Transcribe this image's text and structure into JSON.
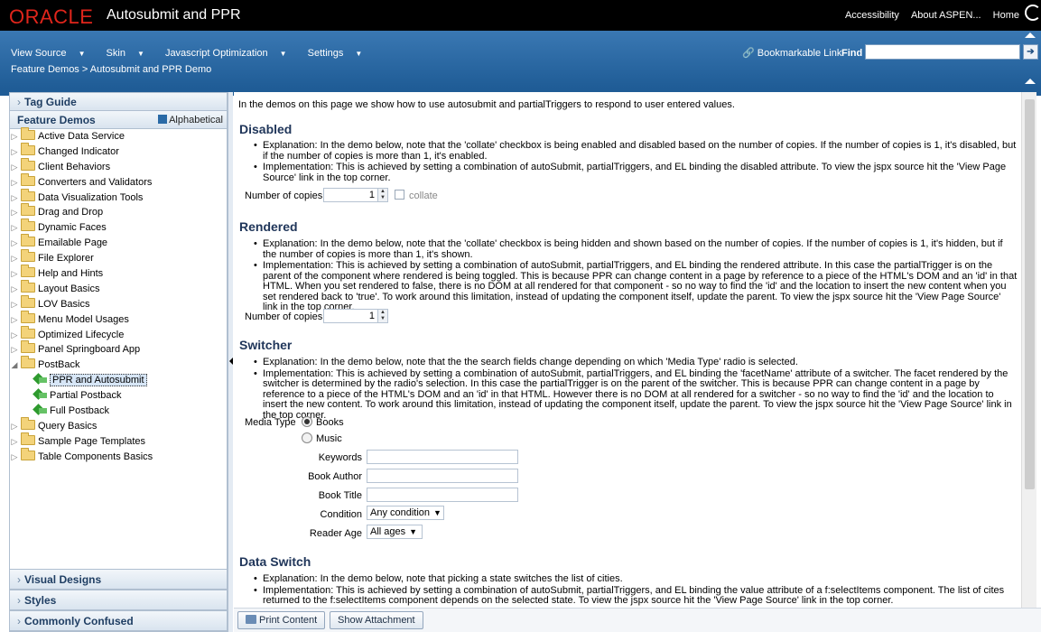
{
  "brand": {
    "logo": "ORACLE",
    "app_name": "Autosubmit and PPR",
    "links": [
      "Accessibility",
      "About ASPEN...",
      "Home"
    ]
  },
  "menu": {
    "items": [
      {
        "label": "View Source"
      },
      {
        "label": "Skin"
      },
      {
        "label": "Javascript Optimization"
      },
      {
        "label": "Settings"
      }
    ],
    "breadcrumb": "Feature Demos > Autosubmit and PPR Demo",
    "bookmarkable_link": "Bookmarkable Link",
    "find_label": "Find",
    "find_value": ""
  },
  "left_panel": {
    "tag_guide": "Tag Guide",
    "feature_demos": "Feature Demos",
    "alphabetical": "Alphabetical",
    "tree": [
      {
        "label": "Active Data Service",
        "type": "folder",
        "level": 0
      },
      {
        "label": "Changed Indicator",
        "type": "folder",
        "level": 0
      },
      {
        "label": "Client Behaviors",
        "type": "folder",
        "level": 0
      },
      {
        "label": "Converters and Validators",
        "type": "folder",
        "level": 0
      },
      {
        "label": "Data Visualization Tools",
        "type": "folder",
        "level": 0
      },
      {
        "label": "Drag and Drop",
        "type": "folder",
        "level": 0
      },
      {
        "label": "Dynamic Faces",
        "type": "folder",
        "level": 0
      },
      {
        "label": "Emailable Page",
        "type": "folder",
        "level": 0
      },
      {
        "label": "File Explorer",
        "type": "folder",
        "level": 0
      },
      {
        "label": "Help and Hints",
        "type": "folder",
        "level": 0
      },
      {
        "label": "Layout Basics",
        "type": "folder",
        "level": 0
      },
      {
        "label": "LOV Basics",
        "type": "folder",
        "level": 0
      },
      {
        "label": "Menu Model Usages",
        "type": "folder",
        "level": 0
      },
      {
        "label": "Optimized Lifecycle",
        "type": "folder",
        "level": 0
      },
      {
        "label": "Panel Springboard App",
        "type": "folder",
        "level": 0
      },
      {
        "label": "PostBack",
        "type": "folder",
        "level": 0,
        "expanded": true
      },
      {
        "label": "PPR and Autosubmit",
        "type": "leaf",
        "level": 1,
        "selected": true
      },
      {
        "label": "Partial Postback",
        "type": "leaf",
        "level": 1
      },
      {
        "label": "Full Postback",
        "type": "leaf",
        "level": 1
      },
      {
        "label": "Query Basics",
        "type": "folder",
        "level": 0
      },
      {
        "label": "Sample Page Templates",
        "type": "folder",
        "level": 0
      },
      {
        "label": "Table Components Basics",
        "type": "folder",
        "level": 0
      }
    ],
    "visual_designs": "Visual Designs",
    "styles": "Styles",
    "commonly_confused": "Commonly Confused"
  },
  "main": {
    "intro": "In the demos on this page we show how to use autosubmit and partialTriggers to respond to user entered values.",
    "disabled": {
      "title": "Disabled",
      "bullets": [
        "Explanation: In the demo below, note that the 'collate' checkbox is being enabled and disabled based on the number of copies. If the number of copies is 1, it's disabled, but if the number of copies is more than 1, it's enabled.",
        "Implementation: This is achieved by setting a combination of autoSubmit, partialTriggers, and EL binding the disabled attribute. To view the jspx source hit the 'View Page Source' link in the top corner."
      ],
      "copies_label": "Number of copies",
      "copies_value": "1",
      "collate_label": "collate"
    },
    "rendered": {
      "title": "Rendered",
      "bullets": [
        "Explanation: In the demo below, note that the 'collate' checkbox is being hidden and shown based on the number of copies. If the number of copies is 1, it's hidden, but if the number of copies is more than 1, it's shown.",
        "Implementation: This is achieved by setting a combination of autoSubmit, partialTriggers, and EL binding the rendered attribute. In this case the partialTrigger is on the parent of the component where rendered is being toggled. This is because PPR can change content in a page by reference to a piece of the HTML's DOM and an 'id' in that HTML. When you set rendered to false, there is no DOM at all rendered for that component - so no way to find the 'id' and the location to insert the new content when you set rendered back to 'true'. To work around this limitation, instead of updating the component itself, update the parent. To view the jspx source hit the 'View Page Source' link in the top corner."
      ],
      "copies_label": "Number of copies",
      "copies_value": "1"
    },
    "switcher": {
      "title": "Switcher",
      "bullets": [
        "Explanation: In the demo below, note that the the search fields change depending on which 'Media Type' radio is selected.",
        "Implementation: This is achieved by setting a combination of autoSubmit, partialTriggers, and EL binding the 'facetName' attribute of a switcher. The facet rendered by the switcher is determined by the radio's selection. In this case the partialTrigger is on the parent of the switcher. This is because PPR can change content in a page by reference to a piece of the HTML's DOM and an 'id' in that HTML. However there is no DOM at all rendered for a switcher - so no way to find the 'id' and the location to insert the new content. To work around this limitation, instead of updating the component itself, update the parent. To view the jspx source hit the 'View Page Source' link in the top corner."
      ],
      "media_type_label": "Media Type",
      "media_books": "Books",
      "media_music": "Music",
      "keywords_label": "Keywords",
      "author_label": "Book Author",
      "title_label": "Book Title",
      "condition_label": "Condition",
      "condition_value": "Any condition",
      "age_label": "Reader Age",
      "age_value": "All ages"
    },
    "data_switch": {
      "title": "Data Switch",
      "bullets": [
        "Explanation: In the demo below, note that picking a state switches the list of cities.",
        "Implementation: This is achieved by setting a combination of autoSubmit, partialTriggers, and EL binding the value attribute of a f:selectItems component. The list of cites returned to the f:selectItems component depends on the selected state. To view the jspx source hit the 'View Page Source' link in the top corner."
      ]
    }
  },
  "bottom_bar": {
    "print_content": "Print Content",
    "show_attachment": "Show Attachment"
  }
}
